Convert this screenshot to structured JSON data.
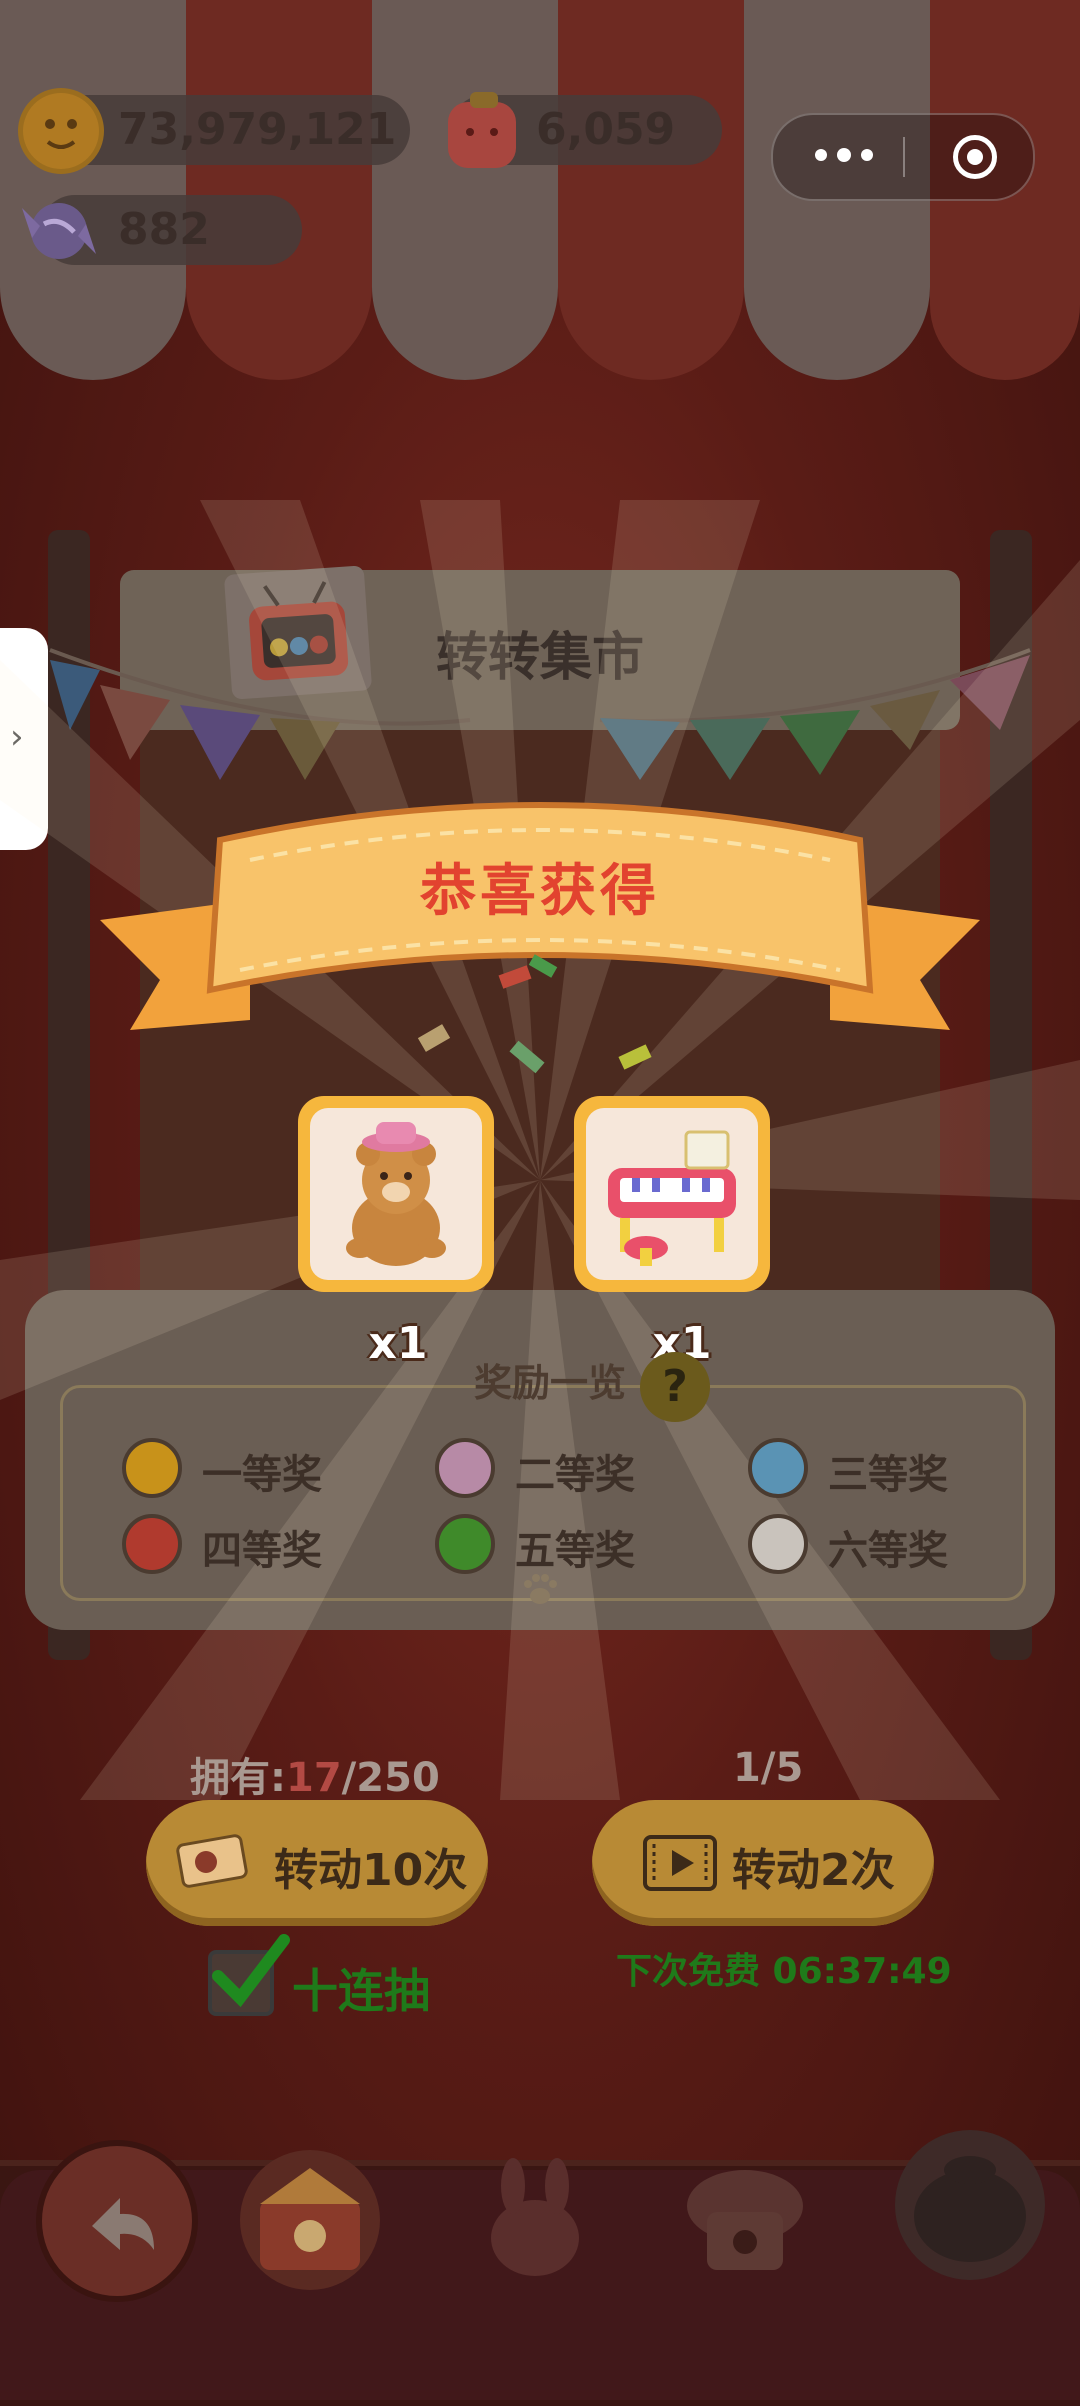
{
  "currencies": {
    "cookie": {
      "value": "73,979,121",
      "icon": "cookie-icon"
    },
    "candy": {
      "value": "6,059",
      "icon": "jelly-candy-icon"
    },
    "gem": {
      "value": "882",
      "icon": "wrapped-candy-icon"
    }
  },
  "capsule": {
    "more_icon": "more-dots-icon",
    "close_icon": "target-icon"
  },
  "booth": {
    "title": "转转集市"
  },
  "reward_popup": {
    "title": "恭喜获得",
    "items": [
      {
        "name": "teddy-bear",
        "qty": "x1"
      },
      {
        "name": "toy-piano",
        "qty": "x1"
      }
    ]
  },
  "prize_list": {
    "title": "奖励一览",
    "help": "?",
    "tiers": [
      {
        "label": "一等奖",
        "color": "#c8921a"
      },
      {
        "label": "二等奖",
        "color": "#b78aa6"
      },
      {
        "label": "三等奖",
        "color": "#5a93b4"
      },
      {
        "label": "四等奖",
        "color": "#b03a2e"
      },
      {
        "label": "五等奖",
        "color": "#3f8a2a"
      },
      {
        "label": "六等奖",
        "color": "#c9c3bc"
      }
    ]
  },
  "controls": {
    "own_label": "拥有:",
    "own_current": "17",
    "own_total": "/250",
    "spin_count": "1/5",
    "spin10_label": "转动10次",
    "spin2_label": "转动2次",
    "ten_pull_label": "十连抽",
    "free_next": "下次免费 06:37:49"
  },
  "colors": {
    "accent_gold": "#f6b73d",
    "banner_red": "#e2432f",
    "green": "#1f7a1a"
  }
}
